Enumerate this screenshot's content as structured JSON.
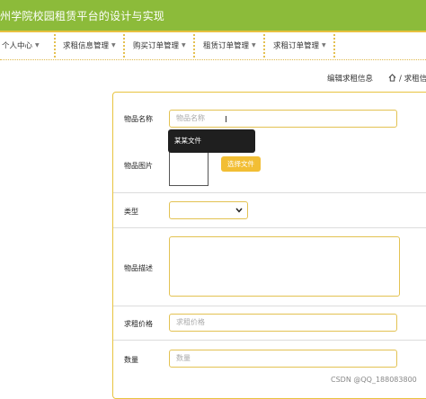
{
  "header": {
    "site_title": "州学院校园租赁平台的设计与实现"
  },
  "nav": {
    "items": [
      {
        "label": "个人中心"
      },
      {
        "label": "求租信息管理"
      },
      {
        "label": "购买订单管理"
      },
      {
        "label": "租赁订单管理"
      },
      {
        "label": "求租订单管理"
      }
    ]
  },
  "breadcrumb": {
    "current": "编辑求租信息",
    "home_path": "/ 求租信"
  },
  "form": {
    "name": {
      "label": "物品名称",
      "placeholder": "物品名称"
    },
    "image": {
      "label": "物品图片",
      "button": "选择文件"
    },
    "tooltip": "某某文件",
    "type": {
      "label": "类型",
      "value": ""
    },
    "description": {
      "label": "物品描述",
      "value": ""
    },
    "price": {
      "label": "求租价格",
      "placeholder": "求租价格"
    },
    "quantity": {
      "label": "数量",
      "placeholder": "数量"
    }
  },
  "watermark": "CSDN @QQ_188083800",
  "colors": {
    "header_bg": "#8cbb3a",
    "accent": "#e8c43f",
    "button": "#f2be34"
  }
}
